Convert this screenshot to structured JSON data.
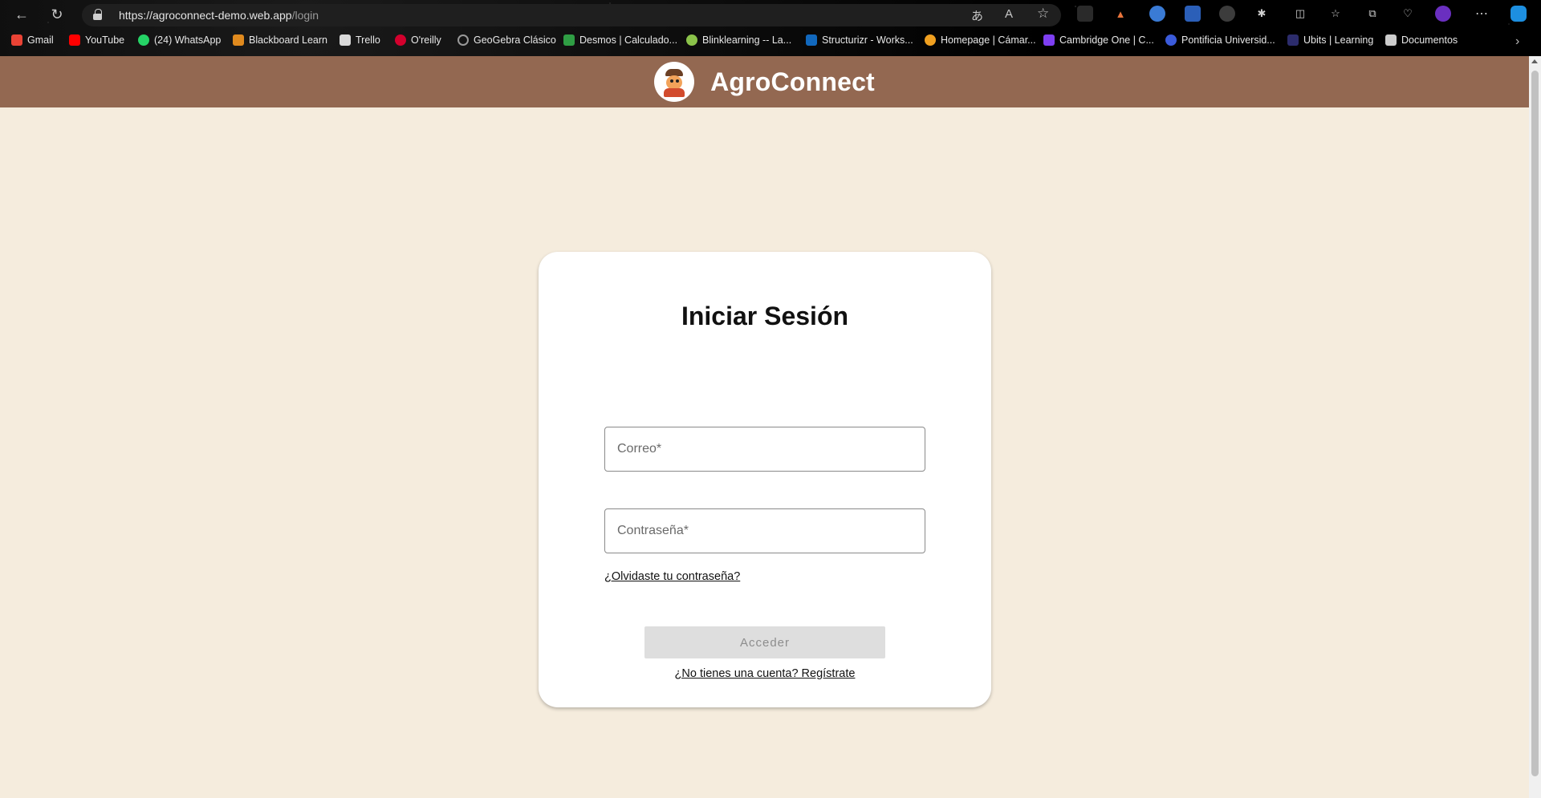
{
  "browser": {
    "url_host": "https://agroconnect-demo.web.app",
    "url_path": "/login",
    "read_aloud_icon": "A",
    "bookmarks": [
      {
        "label": "Gmail",
        "color": "#ea4335"
      },
      {
        "label": "YouTube",
        "color": "#ff0000"
      },
      {
        "label": "(24) WhatsApp",
        "color": "#25d366"
      },
      {
        "label": "Blackboard Learn",
        "color": "#e08a1e"
      },
      {
        "label": "Trello",
        "color": "#d9d9d9"
      },
      {
        "label": "O'reilly",
        "color": "#d3002d"
      },
      {
        "label": "GeoGebra Clásico",
        "color": "#999999"
      },
      {
        "label": "Desmos | Calculado...",
        "color": "#2f9e44"
      },
      {
        "label": "Blinklearning -- La...",
        "color": "#8bc34a"
      },
      {
        "label": "Structurizr - Works...",
        "color": "#1168bd"
      },
      {
        "label": "Homepage | Cámar...",
        "color": "#f0a020"
      },
      {
        "label": "Cambridge One | C...",
        "color": "#7e3ff2"
      },
      {
        "label": "Pontificia Universid...",
        "color": "#3b5bdb"
      },
      {
        "label": "Ubits | Learning",
        "color": "#2c2c6c"
      },
      {
        "label": "Documentos",
        "color": "#cccccc"
      }
    ]
  },
  "app": {
    "brand": "AgroConnect",
    "header_color": "#936851",
    "background_color": "#f5ecdd"
  },
  "login": {
    "title": "Iniciar Sesión",
    "email_placeholder": "Correo*",
    "password_placeholder": "Contraseña*",
    "forgot_password": "¿Olvidaste tu contraseña?",
    "submit_label": "Acceder",
    "submit_disabled": true,
    "register_link": "¿No tienes una cuenta? Regístrate"
  }
}
